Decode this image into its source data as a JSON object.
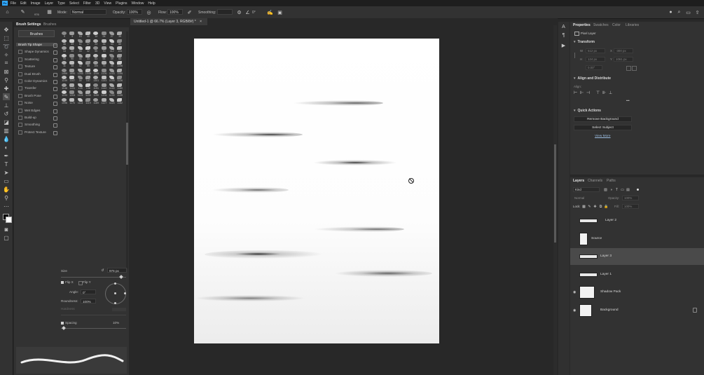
{
  "menu": {
    "items": [
      "File",
      "Edit",
      "Image",
      "Layer",
      "Type",
      "Select",
      "Filter",
      "3D",
      "View",
      "Plugins",
      "Window",
      "Help"
    ]
  },
  "options": {
    "brush_size": "976",
    "mode_label": "Mode:",
    "mode_value": "Normal",
    "opacity_label": "Opacity:",
    "opacity_value": "100%",
    "flow_label": "Flow:",
    "flow_value": "100%",
    "smoothing_label": "Smoothing:",
    "smoothing_value": "",
    "angle_value": "0°"
  },
  "brush_panel": {
    "tab_settings": "Brush Settings",
    "tab_brushes": "Brushes",
    "brushes_button": "Brushes",
    "items": [
      {
        "label": "Brush Tip Shape",
        "checkbox": false
      },
      {
        "label": "Shape Dynamics",
        "checkbox": true
      },
      {
        "label": "Scattering",
        "checkbox": true
      },
      {
        "label": "Texture",
        "checkbox": true
      },
      {
        "label": "Dual Brush",
        "checkbox": true
      },
      {
        "label": "Color Dynamics",
        "checkbox": true
      },
      {
        "label": "Transfer",
        "checkbox": true
      },
      {
        "label": "Brush Pose",
        "checkbox": true
      },
      {
        "label": "Noise",
        "checkbox": true
      },
      {
        "label": "Wet Edges",
        "checkbox": true
      },
      {
        "label": "Build-up",
        "checkbox": true
      },
      {
        "label": "Smoothing",
        "checkbox": true
      },
      {
        "label": "Protect Texture",
        "checkbox": true
      }
    ],
    "tip_numbers": [
      "9",
      "9",
      "15",
      "40",
      "14",
      "24",
      "27",
      "39",
      "46",
      "59",
      "11",
      "17",
      "23",
      "36",
      "44",
      "60",
      "14",
      "26",
      "33",
      "42",
      "55",
      "70",
      "112",
      "134",
      "95",
      "90",
      "36",
      "33",
      "63",
      "66",
      "39",
      "63",
      "11",
      "48",
      "32",
      "55",
      "100",
      "75",
      "45",
      "1106",
      "1499",
      "1850",
      "1245",
      "1045",
      "1149",
      "1126",
      "1143",
      "1155",
      "1149",
      "1147",
      "34",
      "147",
      "1301",
      "1143",
      "1145",
      "1126",
      "1148",
      "1131",
      "128",
      "136",
      "1151",
      "1142",
      "1140",
      "1180",
      "1193",
      "1204",
      "1124",
      "1150",
      "1190",
      "1204",
      "1190",
      "1135",
      "1096",
      "1170",
      "1114",
      "1119",
      "1169",
      "1127",
      "1120",
      "1162"
    ],
    "size_label": "Size",
    "size_value": "976 px",
    "flip_x": "Flip X",
    "flip_y": "Flip Y",
    "angle_label": "Angle:",
    "angle_value": "0°",
    "roundness_label": "Roundness:",
    "roundness_value": "100%",
    "hardness_label": "Hardness",
    "spacing_label": "Spacing",
    "spacing_value": "10%"
  },
  "document": {
    "tab_title": "Untitled-1 @ 66.7% (Layer 3, RGB/8#) *",
    "tab_close": "×"
  },
  "properties": {
    "tab_properties": "Properties",
    "tab_swatches": "Swatches",
    "tab_color": "Color",
    "tab_libraries": "Libraries",
    "layer_type": "Pixel Layer",
    "transform_title": "Transform",
    "w_label": "W",
    "w_value": "512 px",
    "x_label": "X",
    "x_value": "-300 px",
    "h_label": "H",
    "h_value": "124 px",
    "y_label": "Y",
    "y_value": "1061 px",
    "angle_value": "0.00°",
    "align_title": "Align and Distribute",
    "align_label": "Align:",
    "more": "•••",
    "quick_actions_title": "Quick Actions",
    "remove_background": "Remove Background",
    "select_subject": "Select Subject",
    "view_more": "View More"
  },
  "layers": {
    "tab_layers": "Layers",
    "tab_channels": "Channels",
    "tab_paths": "Paths",
    "filter_value": "Kind",
    "blend_mode": "Normal",
    "opacity_label": "Opacity:",
    "opacity_value": "100%",
    "lock_label": "Lock:",
    "fill_label": "Fill:",
    "fill_value": "100%",
    "rows": [
      {
        "name": "Layer 2",
        "visible": false,
        "selected": false
      },
      {
        "name": "Source",
        "visible": false,
        "selected": false
      },
      {
        "name": "Layer 3",
        "visible": false,
        "selected": true
      },
      {
        "name": "Layer 1",
        "visible": false,
        "selected": false
      },
      {
        "name": "Shadow Pack",
        "visible": true,
        "selected": false
      },
      {
        "name": "Background",
        "visible": true,
        "selected": false
      }
    ]
  },
  "colors": {
    "accent": "#31a8ff",
    "panel_bg": "#323232",
    "canvas_bg": "#ffffff"
  }
}
